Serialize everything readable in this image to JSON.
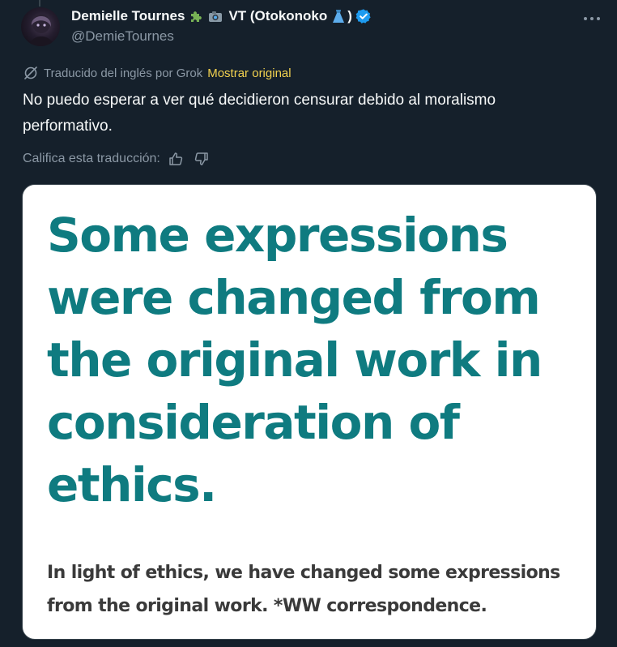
{
  "author": {
    "display_name": "Demielle Tournes",
    "name_suffix": "VT (Otokonoko",
    "name_close": ")",
    "handle": "@DemieTournes",
    "emoji_icons": [
      "puzzle-piece-icon",
      "camera-icon",
      "dress-icon"
    ],
    "verified_color": "#1d9bf0"
  },
  "translation": {
    "label": "Traducido del inglés por Grok",
    "show_original": "Mostrar original",
    "link_color": "#f2d24f"
  },
  "tweet": {
    "text": "No puedo esperar a ver qué decidieron censurar debido al moralismo performativo."
  },
  "rating": {
    "label": "Califica esta traducción:",
    "icons": [
      "thumbs-up-icon",
      "thumbs-down-icon"
    ]
  },
  "media": {
    "headline": "Some expressions were changed from the original work in consideration of ethics.",
    "caption": "In light of ethics, we have changed some expressions from the original work. *WW correspondence.",
    "headline_color": "#0f7b80",
    "caption_color": "#3a3a3a"
  },
  "colors": {
    "background": "#15202b",
    "text_primary": "#f7f9f9",
    "text_secondary": "#8b98a5"
  }
}
